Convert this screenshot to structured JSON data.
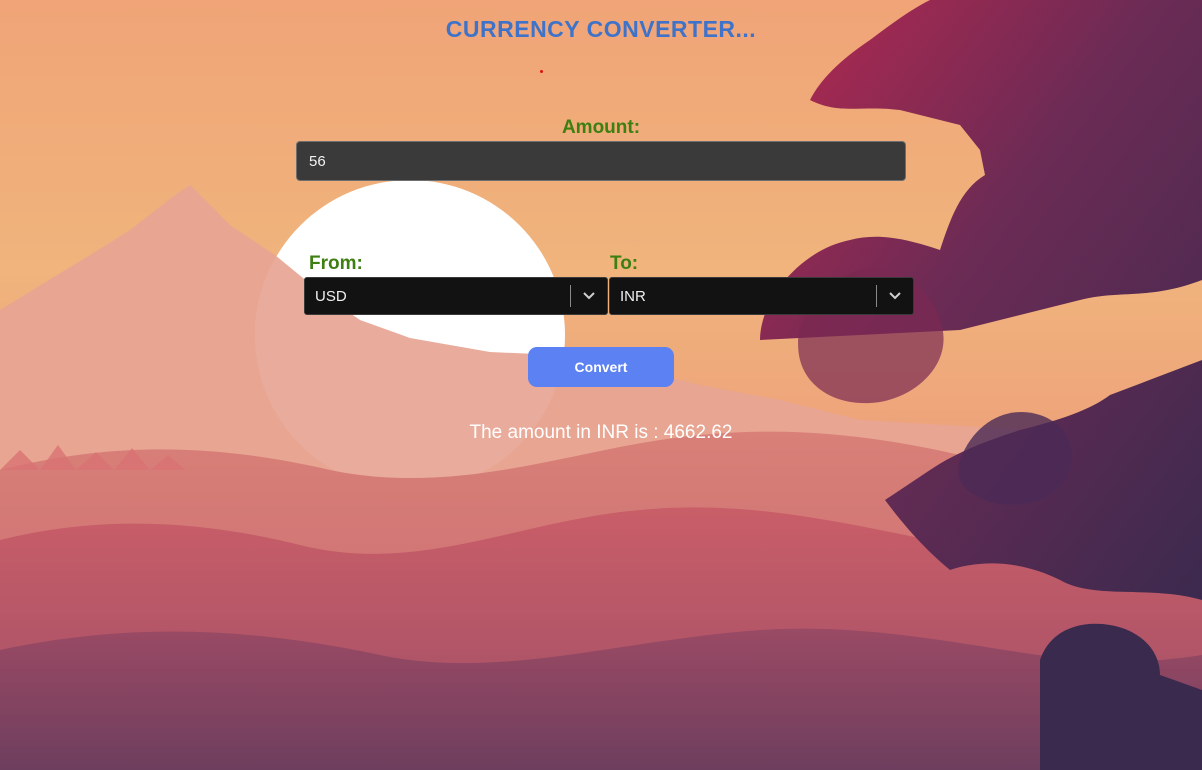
{
  "app": {
    "title": "CURRENCY CONVERTER..."
  },
  "amount": {
    "label": "Amount:",
    "value": "56"
  },
  "from": {
    "label": "From:",
    "selected": "USD"
  },
  "to": {
    "label": "To:",
    "selected": "INR"
  },
  "convert": {
    "label": "Convert"
  },
  "result": {
    "text": "The amount in INR is : 4662.62"
  },
  "icons": {
    "from_dropdown": "chevron-down-icon",
    "to_dropdown": "chevron-down-icon"
  },
  "colors": {
    "title": "#3f73c9",
    "label": "#3e7f12",
    "button": "#5b81f2",
    "input_bg": "#3a3a3a",
    "select_bg": "#121212",
    "result_text": "#ffffff"
  }
}
